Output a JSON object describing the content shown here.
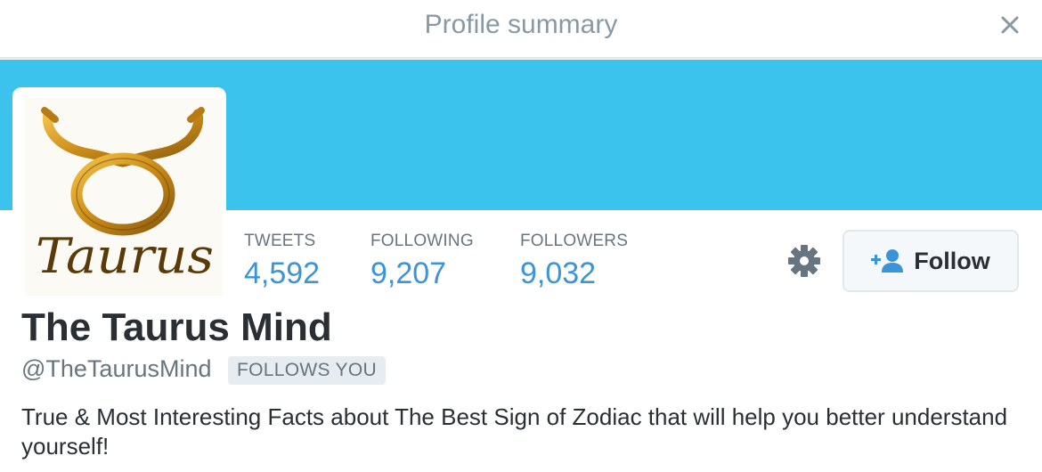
{
  "modal": {
    "title": "Profile summary",
    "close_icon": "close-icon"
  },
  "colors": {
    "banner": "#3bc3ed",
    "stat_value": "#3b94d9",
    "muted_text": "#66757f",
    "primary_text": "#292f33"
  },
  "avatar": {
    "logo_text": "Taurus",
    "icon": "taurus-symbol-icon"
  },
  "stats": [
    {
      "label": "TWEETS",
      "value": "4,592"
    },
    {
      "label": "FOLLOWING",
      "value": "9,207"
    },
    {
      "label": "FOLLOWERS",
      "value": "9,032"
    }
  ],
  "actions": {
    "settings_icon": "gear-icon",
    "follow_icon": "add-user-icon",
    "follow_label": "Follow"
  },
  "profile": {
    "name": "The Taurus Mind",
    "screen_name": "@TheTaurusMind",
    "follows_you_badge": "FOLLOWS YOU",
    "bio": "True & Most Interesting Facts about The Best Sign of Zodiac that will help you better understand yourself!"
  }
}
